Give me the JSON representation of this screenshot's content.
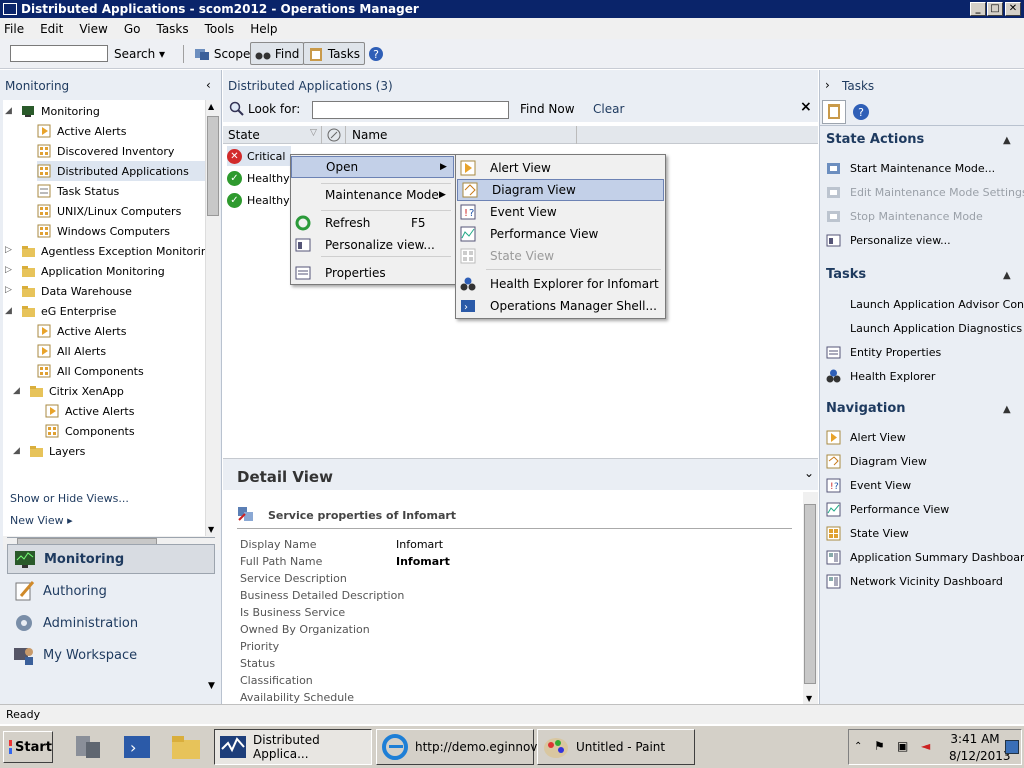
{
  "window": {
    "title": "Distributed Applications - scom2012 - Operations Manager"
  },
  "menubar": [
    "File",
    "Edit",
    "View",
    "Go",
    "Tasks",
    "Tools",
    "Help"
  ],
  "toolbar": {
    "search_label": "Search",
    "scope_label": "Scope",
    "find_label": "Find",
    "tasks_label": "Tasks"
  },
  "left": {
    "header": "Monitoring",
    "tree": [
      {
        "label": "Monitoring"
      },
      {
        "label": "Active Alerts"
      },
      {
        "label": "Discovered Inventory"
      },
      {
        "label": "Distributed Applications"
      },
      {
        "label": "Task Status"
      },
      {
        "label": "UNIX/Linux Computers"
      },
      {
        "label": "Windows Computers"
      },
      {
        "label": "Agentless Exception Monitoring"
      },
      {
        "label": "Application Monitoring"
      },
      {
        "label": "Data Warehouse"
      },
      {
        "label": "eG Enterprise"
      },
      {
        "label": "Active Alerts"
      },
      {
        "label": "All Alerts"
      },
      {
        "label": "All Components"
      },
      {
        "label": "Citrix XenApp"
      },
      {
        "label": "Active Alerts"
      },
      {
        "label": "Components"
      },
      {
        "label": "Layers"
      }
    ],
    "show_hide": "Show or Hide Views...",
    "new_view": "New View ▸",
    "workspaces": [
      "Monitoring",
      "Authoring",
      "Administration",
      "My Workspace"
    ]
  },
  "center": {
    "header": "Distributed Applications (3)",
    "look_for": "Look for:",
    "find_now": "Find Now",
    "clear": "Clear",
    "col_state": "State",
    "col_name": "Name",
    "rows": [
      {
        "state": "Critical"
      },
      {
        "state": "Healthy"
      },
      {
        "state": "Healthy"
      }
    ],
    "detail_header": "Detail View",
    "detail_title": "Service properties of Infomart",
    "props": [
      {
        "k": "Display Name",
        "v": "Infomart",
        "bold": false
      },
      {
        "k": "Full Path Name",
        "v": "Infomart",
        "bold": true
      },
      {
        "k": "Service Description",
        "v": ""
      },
      {
        "k": "Business Detailed Description",
        "v": ""
      },
      {
        "k": "Is Business Service",
        "v": ""
      },
      {
        "k": "Owned By Organization",
        "v": ""
      },
      {
        "k": "Priority",
        "v": ""
      },
      {
        "k": "Status",
        "v": ""
      },
      {
        "k": "Classification",
        "v": ""
      },
      {
        "k": "Availability Schedule",
        "v": ""
      }
    ]
  },
  "context_menu": {
    "open": "Open",
    "maintenance": "Maintenance Mode",
    "refresh": "Refresh",
    "refresh_key": "F5",
    "personalize": "Personalize view...",
    "properties": "Properties"
  },
  "submenu": {
    "items": [
      "Alert View",
      "Diagram View",
      "Event View",
      "Performance View",
      "State View",
      "Health Explorer for Infomart",
      "Operations Manager Shell..."
    ]
  },
  "right": {
    "header": "Tasks",
    "state_actions": "State Actions",
    "state_items": [
      "Start Maintenance Mode...",
      "Edit Maintenance Mode Settings...",
      "Stop Maintenance Mode",
      "Personalize view..."
    ],
    "tasks": "Tasks",
    "task_items": [
      "Launch Application Advisor Console",
      "Launch Application Diagnostics Con",
      "Entity Properties",
      "Health Explorer"
    ],
    "navigation": "Navigation",
    "nav_items": [
      "Alert View",
      "Diagram View",
      "Event View",
      "Performance View",
      "State View",
      "Application Summary Dashboard",
      "Network Vicinity Dashboard"
    ]
  },
  "status": "Ready",
  "taskbar": {
    "start": "Start",
    "tasks": [
      "Distributed Applica...",
      "http://demo.eginnov...",
      "Untitled - Paint"
    ],
    "time": "3:41 AM",
    "date": "8/12/2013"
  },
  "colors": {
    "accent": "#0a246a",
    "critical": "#d22b2b",
    "healthy": "#2e9a2e"
  }
}
